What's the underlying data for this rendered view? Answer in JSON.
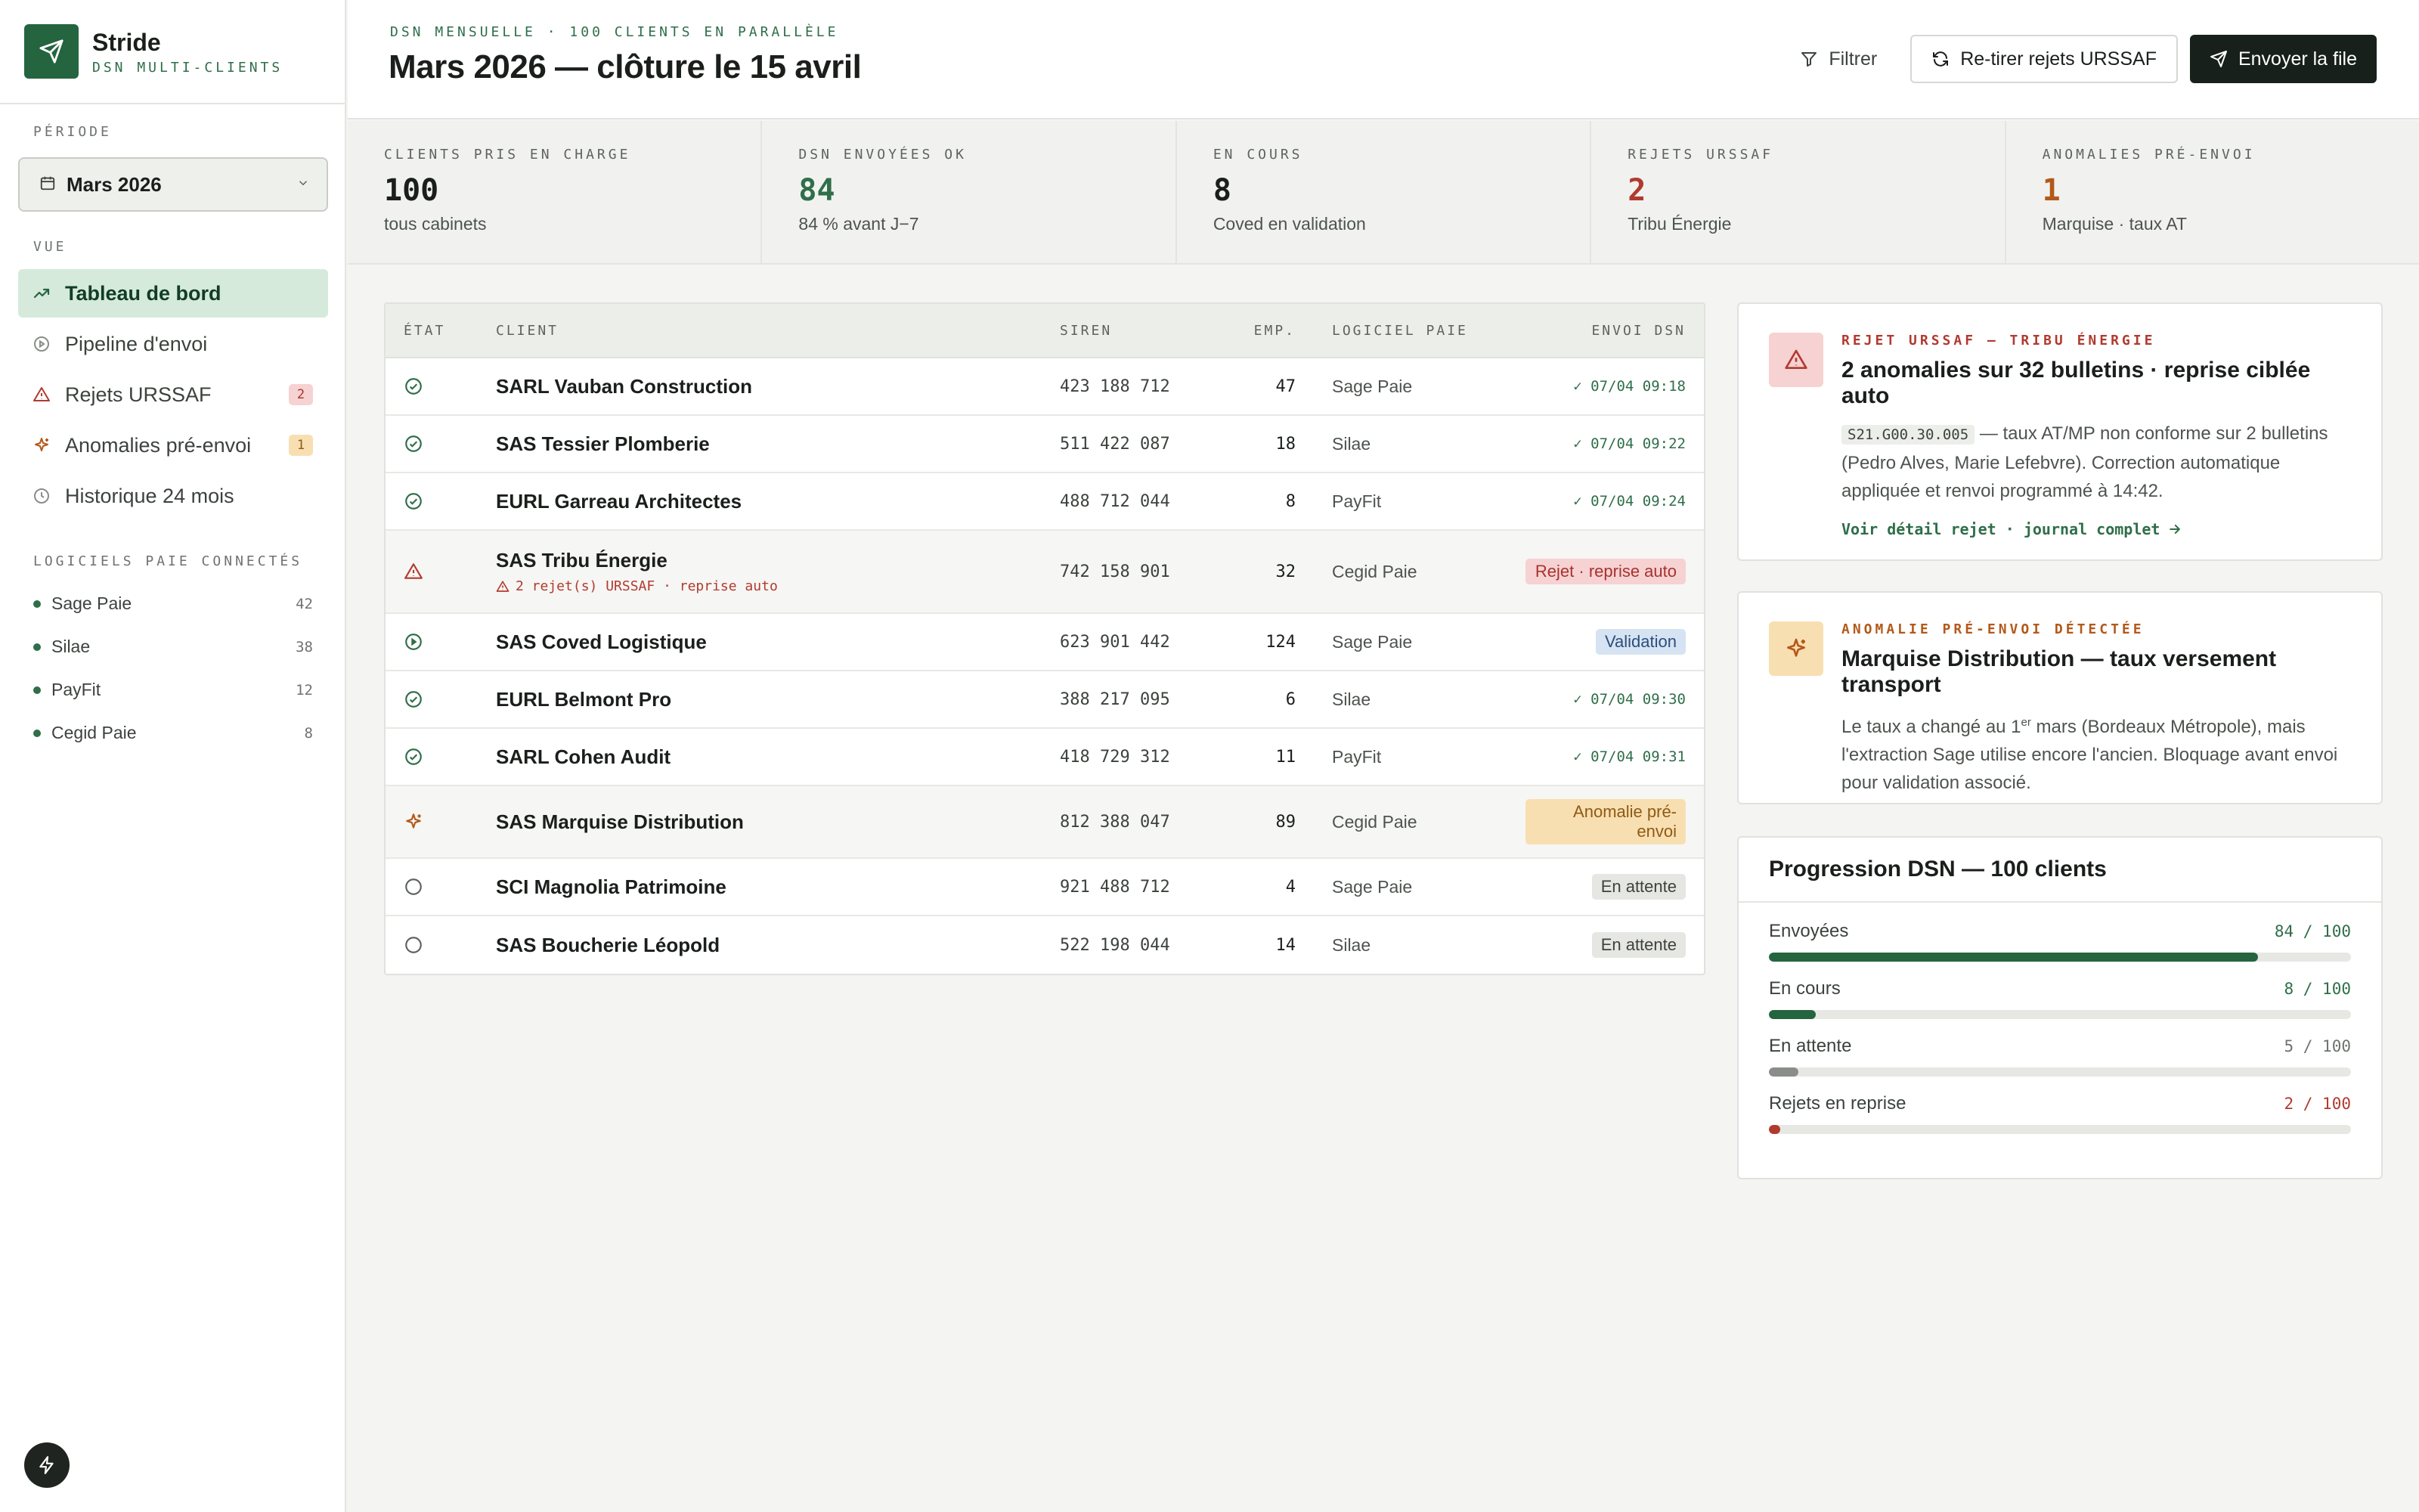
{
  "brand": {
    "name": "Stride",
    "sub": "DSN MULTI-CLIENTS"
  },
  "sidebar": {
    "period_title": "PÉRIODE",
    "period_value": "Mars 2026",
    "view_title": "VUE",
    "nav": [
      {
        "label": "Tableau de bord",
        "icon": "trending-up-icon",
        "active": true,
        "badge": ""
      },
      {
        "label": "Pipeline d'envoi",
        "icon": "play-circle-icon",
        "active": false,
        "badge": ""
      },
      {
        "label": "Rejets URSSAF",
        "icon": "warning-triangle-icon",
        "active": false,
        "badge": "2"
      },
      {
        "label": "Anomalies pré-envoi",
        "icon": "sparkle-icon",
        "active": false,
        "badge": "1"
      },
      {
        "label": "Historique 24 mois",
        "icon": "clock-icon",
        "active": false,
        "badge": ""
      }
    ],
    "software_title": "LOGICIELS PAIE CONNECTÉS",
    "software": [
      {
        "name": "Sage Paie",
        "count": "42"
      },
      {
        "name": "Silae",
        "count": "38"
      },
      {
        "name": "PayFit",
        "count": "12"
      },
      {
        "name": "Cegid Paie",
        "count": "8"
      }
    ]
  },
  "header": {
    "eyebrow": "DSN MENSUELLE · 100 CLIENTS EN PARALLÈLE",
    "title": "Mars 2026 — clôture le 15 avril",
    "filter_label": "Filtrer",
    "retry_label": "Re-tirer rejets URSSAF",
    "send_label": "Envoyer la file"
  },
  "kpis": [
    {
      "label": "CLIENTS PRIS EN CHARGE",
      "value": "100",
      "sub": "tous cabinets",
      "tone": ""
    },
    {
      "label": "DSN ENVOYÉES OK",
      "value": "84",
      "sub": "84 % avant J−7",
      "tone": "v-green"
    },
    {
      "label": "EN COURS",
      "value": "8",
      "sub": "Coved en validation",
      "tone": ""
    },
    {
      "label": "REJETS URSSAF",
      "value": "2",
      "sub": "Tribu Énergie",
      "tone": "v-red"
    },
    {
      "label": "ANOMALIES PRÉ-ENVOI",
      "value": "1",
      "sub": "Marquise · taux AT",
      "tone": "v-orange"
    }
  ],
  "table": {
    "headers": {
      "state": "ÉTAT",
      "client": "CLIENT",
      "siren": "SIREN",
      "emp": "EMP.",
      "software": "LOGICIEL PAIE",
      "dsn": "ENVOI DSN"
    },
    "rows": [
      {
        "state": "ok",
        "client": "SARL Vauban Construction",
        "note": "",
        "siren": "423 188 712",
        "emp": "47",
        "software": "Sage Paie",
        "dsn_kind": "sent",
        "dsn": "✓ 07/04 09:18"
      },
      {
        "state": "ok",
        "client": "SAS Tessier Plomberie",
        "note": "",
        "siren": "511 422 087",
        "emp": "18",
        "software": "Silae",
        "dsn_kind": "sent",
        "dsn": "✓ 07/04 09:22"
      },
      {
        "state": "ok",
        "client": "EURL Garreau Architectes",
        "note": "",
        "siren": "488 712 044",
        "emp": "8",
        "software": "PayFit",
        "dsn_kind": "sent",
        "dsn": "✓ 07/04 09:24"
      },
      {
        "state": "reject",
        "client": "SAS Tribu Énergie",
        "note": "2 rejet(s) URSSAF · reprise auto",
        "siren": "742 158 901",
        "emp": "32",
        "software": "Cegid Paie",
        "dsn_kind": "reject",
        "dsn": "Rejet · reprise auto"
      },
      {
        "state": "pending",
        "client": "SAS Coved Logistique",
        "note": "",
        "siren": "623 901 442",
        "emp": "124",
        "software": "Sage Paie",
        "dsn_kind": "validation",
        "dsn": "Validation"
      },
      {
        "state": "ok",
        "client": "EURL Belmont Pro",
        "note": "",
        "siren": "388 217 095",
        "emp": "6",
        "software": "Silae",
        "dsn_kind": "sent",
        "dsn": "✓ 07/04 09:30"
      },
      {
        "state": "ok",
        "client": "SARL Cohen Audit",
        "note": "",
        "siren": "418 729 312",
        "emp": "11",
        "software": "PayFit",
        "dsn_kind": "sent",
        "dsn": "✓ 07/04 09:31"
      },
      {
        "state": "anomaly",
        "client": "SAS Marquise Distribution",
        "note": "",
        "siren": "812 388 047",
        "emp": "89",
        "software": "Cegid Paie",
        "dsn_kind": "anomaly",
        "dsn": "Anomalie pré-envoi"
      },
      {
        "state": "waiting",
        "client": "SCI Magnolia Patrimoine",
        "note": "",
        "siren": "921 488 712",
        "emp": "4",
        "software": "Sage Paie",
        "dsn_kind": "waiting",
        "dsn": "En attente"
      },
      {
        "state": "waiting",
        "client": "SAS Boucherie Léopold",
        "note": "",
        "siren": "522 198 044",
        "emp": "14",
        "software": "Silae",
        "dsn_kind": "waiting",
        "dsn": "En attente"
      }
    ]
  },
  "reject_card": {
    "eyebrow": "REJET URSSAF — TRIBU ÉNERGIE",
    "title": "2 anomalies sur 32 bulletins · reprise ciblée auto",
    "code": "S21.G00.30.005",
    "text": "— taux AT/MP non conforme sur 2 bulletins (Pedro Alves, Marie Lefebvre). Correction automatique appliquée et renvoi programmé à 14:42.",
    "link": "Voir détail rejet · journal complet"
  },
  "anomaly_card": {
    "eyebrow": "ANOMALIE PRÉ-ENVOI DÉTECTÉE",
    "title": "Marquise Distribution — taux versement transport",
    "text_before": "Le taux a changé au 1",
    "text_sup": "er",
    "text_after": " mars (Bordeaux Métropole), mais l'extraction Sage utilise encore l'ancien. Bloquage avant envoi pour validation associé."
  },
  "progress": {
    "title": "Progression DSN — 100 clients",
    "rows": [
      {
        "label": "Envoyées",
        "value": "84 / 100",
        "fraction": 0.84,
        "color": "#24643f",
        "value_color": "#2f6e49"
      },
      {
        "label": "En cours",
        "value": "8 / 100",
        "fraction": 0.08,
        "color": "#24643f",
        "value_color": "#2f6e49"
      },
      {
        "label": "En attente",
        "value": "5 / 100",
        "fraction": 0.05,
        "color": "#8a8e8a",
        "value_color": "#6e736e"
      },
      {
        "label": "Rejets en reprise",
        "value": "2 / 100",
        "fraction": 0.02,
        "color": "#b13a2f",
        "value_color": "#b13a2f"
      }
    ]
  },
  "colors": {
    "accent": "#24643f",
    "danger": "#b13a2f",
    "warning": "#b3591a"
  }
}
